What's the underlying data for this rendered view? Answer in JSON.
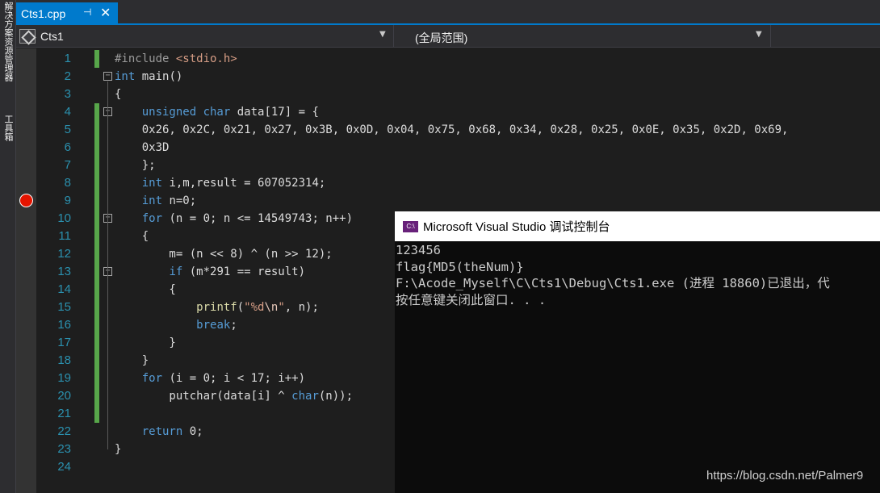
{
  "side_panel": {
    "label_solution_explorer": "解决方案资源管理器",
    "label_toolbox": "工具箱"
  },
  "tab": {
    "title": "Cts1.cpp",
    "pin_glyph": "⊣",
    "close_glyph": "✕"
  },
  "nav": {
    "project": "Cts1",
    "scope": "(全局范围)",
    "dropdown_glyph": "▼"
  },
  "editor": {
    "line_numbers": [
      "1",
      "2",
      "3",
      "4",
      "5",
      "6",
      "7",
      "8",
      "9",
      "10",
      "11",
      "12",
      "13",
      "14",
      "15",
      "16",
      "17",
      "18",
      "19",
      "20",
      "21",
      "22",
      "23",
      "24"
    ],
    "lines": [
      [
        [
          "pp",
          "#include "
        ],
        [
          "inc",
          "<stdio.h>"
        ]
      ],
      [
        [
          "kw",
          "int"
        ],
        [
          "txt",
          " main()"
        ]
      ],
      [
        [
          "txt",
          "{"
        ]
      ],
      [
        [
          "txt",
          "    "
        ],
        [
          "kw",
          "unsigned char"
        ],
        [
          "txt",
          " data[17] = {"
        ]
      ],
      [
        [
          "txt",
          "    0x26, 0x2C, 0x21, 0x27, 0x3B, 0x0D, 0x04, 0x75, 0x68, 0x34, 0x28, 0x25, 0x0E, 0x35, 0x2D, 0x69,"
        ]
      ],
      [
        [
          "txt",
          "    0x3D"
        ]
      ],
      [
        [
          "txt",
          "    };"
        ]
      ],
      [
        [
          "txt",
          "    "
        ],
        [
          "kw",
          "int"
        ],
        [
          "txt",
          " i,m,result = 607052314;"
        ]
      ],
      [
        [
          "txt",
          "    "
        ],
        [
          "kw",
          "int"
        ],
        [
          "txt",
          " n=0;"
        ]
      ],
      [
        [
          "txt",
          "    "
        ],
        [
          "kw",
          "for"
        ],
        [
          "txt",
          " (n = 0; n <= 14549743; n++)"
        ]
      ],
      [
        [
          "txt",
          "    {"
        ]
      ],
      [
        [
          "txt",
          "        m= (n << 8) ^ (n >> 12);"
        ]
      ],
      [
        [
          "txt",
          "        "
        ],
        [
          "kw",
          "if"
        ],
        [
          "txt",
          " (m*291 == result)"
        ]
      ],
      [
        [
          "txt",
          "        {"
        ]
      ],
      [
        [
          "txt",
          "            "
        ],
        [
          "fn",
          "printf"
        ],
        [
          "txt",
          "("
        ],
        [
          "str",
          "\"%d"
        ],
        [
          "esc",
          "\\n"
        ],
        [
          "str",
          "\""
        ],
        [
          "txt",
          ", n);"
        ]
      ],
      [
        [
          "txt",
          "            "
        ],
        [
          "kw",
          "break"
        ],
        [
          "txt",
          ";"
        ]
      ],
      [
        [
          "txt",
          "        }"
        ]
      ],
      [
        [
          "txt",
          "    }"
        ]
      ],
      [
        [
          "txt",
          "    "
        ],
        [
          "kw",
          "for"
        ],
        [
          "txt",
          " (i = 0; i < 17; i++)"
        ]
      ],
      [
        [
          "txt",
          "        putchar(data[i] ^ "
        ],
        [
          "kw",
          "char"
        ],
        [
          "txt",
          "(n));"
        ]
      ],
      [
        [
          "txt",
          ""
        ]
      ],
      [
        [
          "txt",
          "    "
        ],
        [
          "kw",
          "return"
        ],
        [
          "txt",
          " 0;"
        ]
      ],
      [
        [
          "txt",
          "}"
        ]
      ],
      [
        [
          "txt",
          ""
        ]
      ]
    ],
    "changed_lines": [
      1,
      4,
      5,
      6,
      7,
      8,
      9,
      10,
      11,
      12,
      13,
      14,
      15,
      16,
      17,
      18,
      19,
      20,
      21
    ],
    "fold_lines": [
      2,
      4,
      10,
      13
    ],
    "breakpoint_line": 9
  },
  "console": {
    "title": "Microsoft Visual Studio 调试控制台",
    "icon_text": "C:\\",
    "output": [
      "123456",
      "flag{MD5(theNum)}",
      "F:\\Acode_Myself\\C\\Cts1\\Debug\\Cts1.exe (进程 18860)已退出，代",
      "按任意键关闭此窗口. . ."
    ]
  },
  "watermark": "https://blog.csdn.net/Palmer9",
  "colors": {
    "accent": "#007acc",
    "keyword": "#569cd6",
    "line_number": "#2b91af",
    "change_bar": "#57a64a",
    "breakpoint": "#e51400"
  }
}
